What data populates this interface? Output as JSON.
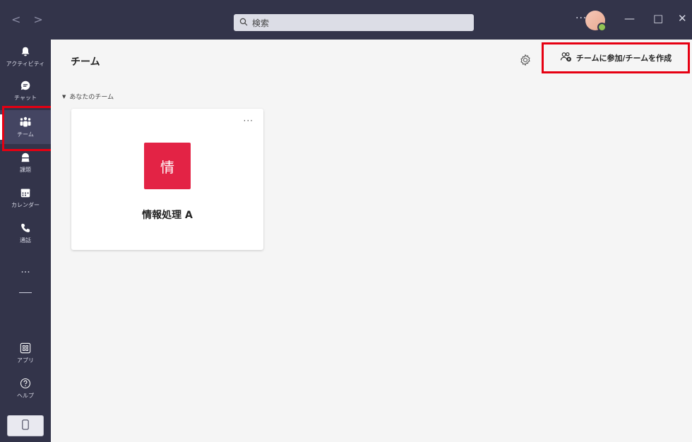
{
  "titlebar": {
    "search_placeholder": "検索",
    "more_label": "···",
    "minimize": "—",
    "maximize": "□",
    "close": "✕"
  },
  "rail": {
    "items": [
      {
        "label": "アクティビティ",
        "icon": "bell-icon"
      },
      {
        "label": "チャット",
        "icon": "chat-icon"
      },
      {
        "label": "チーム",
        "icon": "teams-icon",
        "active": true
      },
      {
        "label": "課題",
        "icon": "assignments-icon"
      },
      {
        "label": "カレンダー",
        "icon": "calendar-icon"
      },
      {
        "label": "通話",
        "icon": "phone-icon"
      }
    ],
    "more": "···",
    "apps_label": "アプリ",
    "help_label": "ヘルプ"
  },
  "main": {
    "title": "チーム",
    "join_create_label": "チームに参加/チームを作成",
    "section_label": "あなたのチーム",
    "teams": [
      {
        "tile_char": "情",
        "name": "情報処理 A",
        "tile_color": "#e32345"
      }
    ],
    "card_more": "···"
  },
  "colors": {
    "rail_bg": "#33344a",
    "highlight": "#e60012",
    "presence": "#92c353"
  }
}
